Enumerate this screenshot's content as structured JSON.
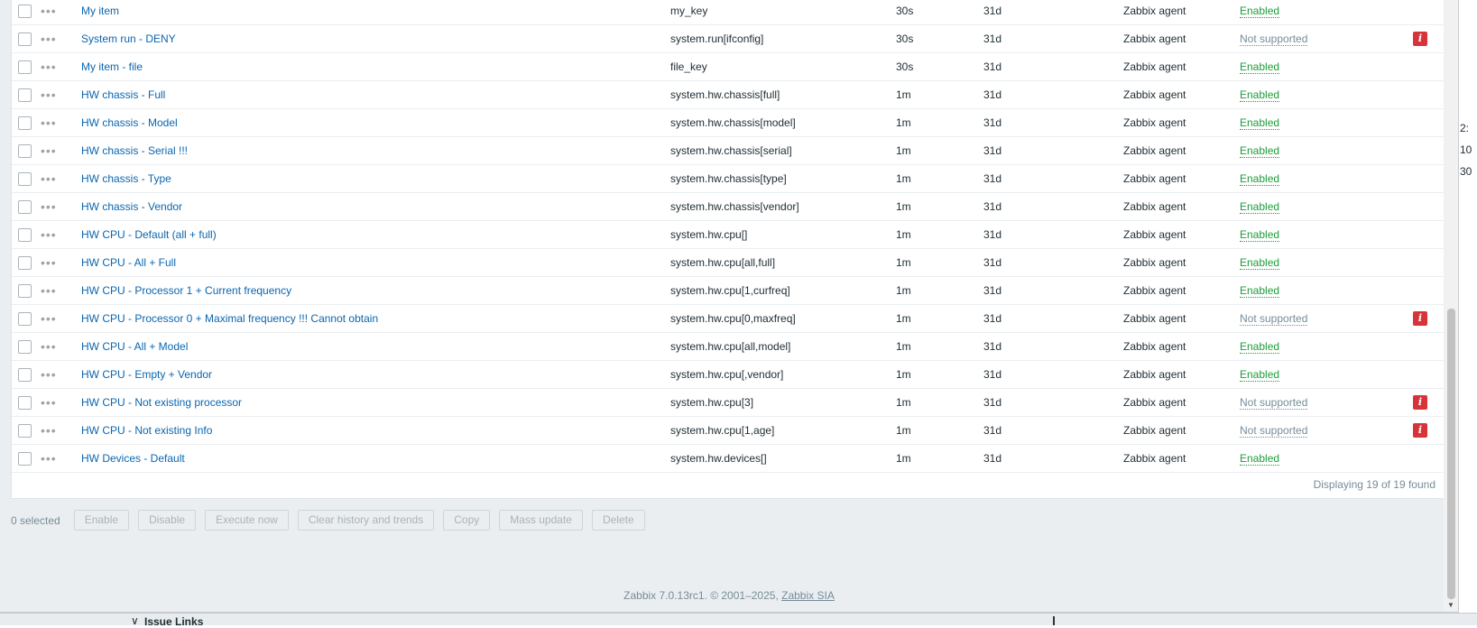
{
  "rows": [
    {
      "name": "My item",
      "key": "my_key",
      "interval": "30s",
      "history": "31d",
      "type": "Zabbix agent",
      "status": "Enabled",
      "info": false
    },
    {
      "name": "System run - DENY",
      "key": "system.run[ifconfig]",
      "interval": "30s",
      "history": "31d",
      "type": "Zabbix agent",
      "status": "Not supported",
      "info": true
    },
    {
      "name": "My item - file",
      "key": "file_key",
      "interval": "30s",
      "history": "31d",
      "type": "Zabbix agent",
      "status": "Enabled",
      "info": false
    },
    {
      "name": "HW chassis - Full",
      "key": "system.hw.chassis[full]",
      "interval": "1m",
      "history": "31d",
      "type": "Zabbix agent",
      "status": "Enabled",
      "info": false
    },
    {
      "name": "HW chassis - Model",
      "key": "system.hw.chassis[model]",
      "interval": "1m",
      "history": "31d",
      "type": "Zabbix agent",
      "status": "Enabled",
      "info": false
    },
    {
      "name": "HW chassis - Serial !!!",
      "key": "system.hw.chassis[serial]",
      "interval": "1m",
      "history": "31d",
      "type": "Zabbix agent",
      "status": "Enabled",
      "info": false
    },
    {
      "name": "HW chassis - Type",
      "key": "system.hw.chassis[type]",
      "interval": "1m",
      "history": "31d",
      "type": "Zabbix agent",
      "status": "Enabled",
      "info": false
    },
    {
      "name": "HW chassis - Vendor",
      "key": "system.hw.chassis[vendor]",
      "interval": "1m",
      "history": "31d",
      "type": "Zabbix agent",
      "status": "Enabled",
      "info": false
    },
    {
      "name": "HW CPU - Default (all + full)",
      "key": "system.hw.cpu[]",
      "interval": "1m",
      "history": "31d",
      "type": "Zabbix agent",
      "status": "Enabled",
      "info": false
    },
    {
      "name": "HW CPU - All + Full",
      "key": "system.hw.cpu[all,full]",
      "interval": "1m",
      "history": "31d",
      "type": "Zabbix agent",
      "status": "Enabled",
      "info": false
    },
    {
      "name": "HW CPU - Processor 1 + Current frequency",
      "key": "system.hw.cpu[1,curfreq]",
      "interval": "1m",
      "history": "31d",
      "type": "Zabbix agent",
      "status": "Enabled",
      "info": false
    },
    {
      "name": "HW CPU - Processor 0 + Maximal frequency !!! Cannot obtain",
      "key": "system.hw.cpu[0,maxfreq]",
      "interval": "1m",
      "history": "31d",
      "type": "Zabbix agent",
      "status": "Not supported",
      "info": true
    },
    {
      "name": "HW CPU - All + Model",
      "key": "system.hw.cpu[all,model]",
      "interval": "1m",
      "history": "31d",
      "type": "Zabbix agent",
      "status": "Enabled",
      "info": false
    },
    {
      "name": "HW CPU - Empty + Vendor",
      "key": "system.hw.cpu[,vendor]",
      "interval": "1m",
      "history": "31d",
      "type": "Zabbix agent",
      "status": "Enabled",
      "info": false
    },
    {
      "name": "HW CPU - Not existing processor",
      "key": "system.hw.cpu[3]",
      "interval": "1m",
      "history": "31d",
      "type": "Zabbix agent",
      "status": "Not supported",
      "info": true
    },
    {
      "name": "HW CPU - Not existing Info",
      "key": "system.hw.cpu[1,age]",
      "interval": "1m",
      "history": "31d",
      "type": "Zabbix agent",
      "status": "Not supported",
      "info": true
    },
    {
      "name": "HW Devices - Default",
      "key": "system.hw.devices[]",
      "interval": "1m",
      "history": "31d",
      "type": "Zabbix agent",
      "status": "Enabled",
      "info": false
    }
  ],
  "row_dots": "•••",
  "info_glyph": "i",
  "paging": "Displaying 19 of 19 found",
  "actions": {
    "selected": "0 selected",
    "enable": "Enable",
    "disable": "Disable",
    "execute": "Execute now",
    "clear": "Clear history and trends",
    "copy": "Copy",
    "mass_update": "Mass update",
    "delete": "Delete"
  },
  "footer": {
    "text": "Zabbix 7.0.13rc1. © 2001–2025, ",
    "link": "Zabbix SIA"
  },
  "peek": {
    "chev": "∨",
    "label": "Issue Links",
    "right": [
      "2:",
      "10",
      "30"
    ]
  },
  "colors": {
    "link": "#0a66b0",
    "enabled": "#1b9e3a",
    "not_supported": "#768d99",
    "info_badge": "#d9333a"
  }
}
